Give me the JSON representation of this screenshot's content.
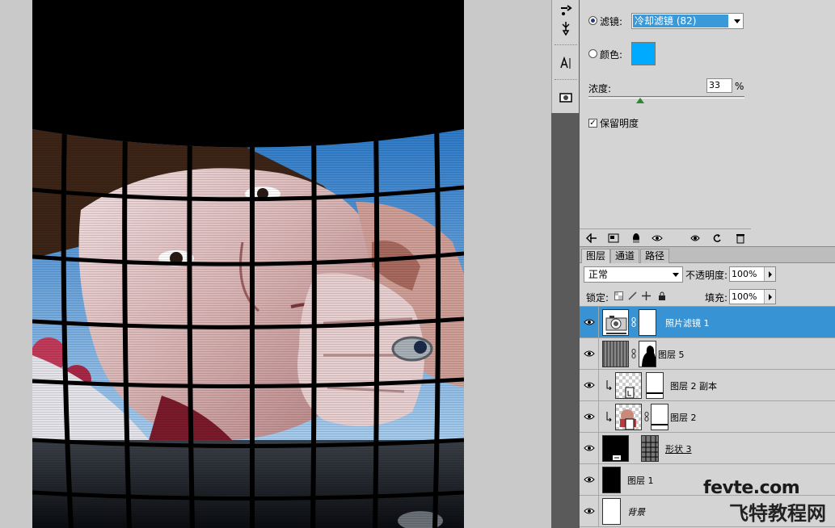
{
  "adjustments": {
    "filter_label": "滤镜:",
    "filter_value": "冷却滤镜 (82)",
    "color_label": "颜色:",
    "color_hex": "#00aaff",
    "density_label": "浓度:",
    "density_value": "33",
    "density_unit": "%",
    "density_fraction": 0.33,
    "preserve_label": "保留明度",
    "preserve_checked": true,
    "bottom_icons": [
      "back-arrow-icon",
      "expand-view-icon",
      "clip-layer-icon",
      "eye-icon",
      "view-previous-icon",
      "reset-icon",
      "trash-icon"
    ]
  },
  "layers_panel": {
    "tabs": [
      {
        "label": "图层",
        "active": true
      },
      {
        "label": "通道",
        "active": false
      },
      {
        "label": "路径",
        "active": false
      }
    ],
    "blend_mode": "正常",
    "opacity_label": "不透明度:",
    "opacity_value": "100%",
    "lock_label": "锁定:",
    "fill_label": "填充:",
    "fill_value": "100%",
    "layers": [
      {
        "name": "照片滤镜 1",
        "selected": true,
        "visible": true
      },
      {
        "name": "图层 5",
        "selected": false,
        "visible": true
      },
      {
        "name": "图层 2 副本",
        "selected": false,
        "visible": true
      },
      {
        "name": "图层 2",
        "selected": false,
        "visible": true
      },
      {
        "name": "形状 3",
        "selected": false,
        "visible": true
      },
      {
        "name": "图层 1",
        "selected": false,
        "visible": true
      },
      {
        "name": "背景",
        "selected": false,
        "visible": true
      }
    ]
  },
  "tools": [
    "clone-source-icon",
    "brush-settings-icon",
    "character-icon",
    "quick-mask-icon"
  ],
  "watermark": {
    "site": "fevte.com",
    "name": "飞特教程网"
  }
}
